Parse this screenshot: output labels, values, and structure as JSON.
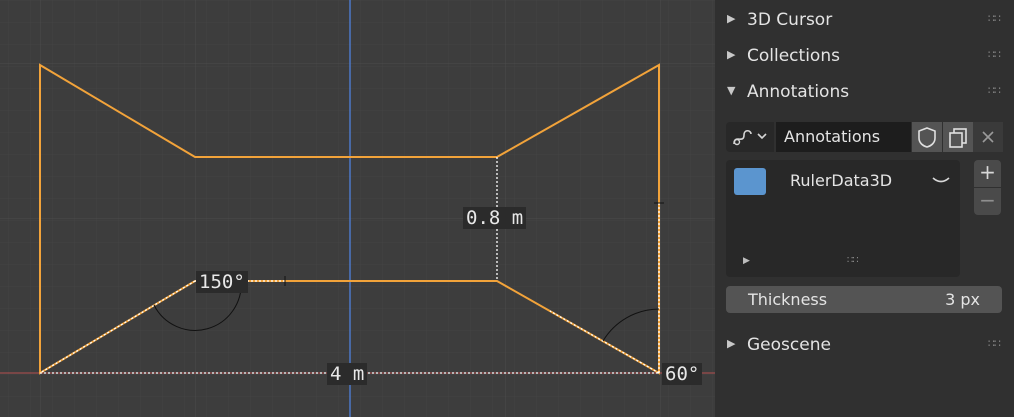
{
  "viewport": {
    "ruler_labels": {
      "height": "0.8 m",
      "angle_left": "150°",
      "width": "4 m",
      "angle_right": "60°"
    },
    "colors": {
      "grid_bg": "#3d3d3d",
      "shape_outline": "#f2a33a",
      "y_axis": "#4d78c8",
      "x_axis": "#b55050"
    }
  },
  "panel": {
    "sections": {
      "cursor": {
        "label": "3D Cursor",
        "expanded": false
      },
      "collections": {
        "label": "Collections",
        "expanded": false
      },
      "annotations": {
        "label": "Annotations",
        "expanded": true
      },
      "geoscene": {
        "label": "Geoscene",
        "expanded": false
      }
    },
    "annotations": {
      "name": "Annotations",
      "layer": {
        "name": "RulerData3D",
        "color": "#5b95cf"
      },
      "add_label": "+",
      "remove_label": "−",
      "thickness": {
        "label": "Thickness",
        "value": "3 px"
      }
    },
    "icons": [
      "stroke-icon",
      "chevron-down-icon",
      "shield-icon",
      "copy-icon",
      "close-icon",
      "grip-icon",
      "eye-closed-icon"
    ]
  }
}
